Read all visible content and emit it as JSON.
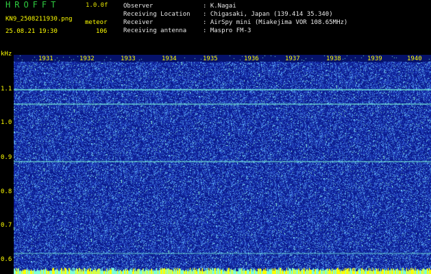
{
  "header": {
    "brand": "HROFFT",
    "version": "1.0.0f",
    "filename": "KN9_2508211930.png",
    "mode": "meteor",
    "datetime": "25.08.21 19:30",
    "count": "106"
  },
  "info": [
    {
      "label": "Observer",
      "value": ": K.Nagai"
    },
    {
      "label": "Receiving Location",
      "value": ": Chigasaki, Japan (139.414 35.340)"
    },
    {
      "label": "Receiver",
      "value": ": AirSpy mini (Miakejima VOR 108.65MHz)"
    },
    {
      "label": "Receiving antenna",
      "value": ": Maspro FM-3"
    }
  ],
  "axes": {
    "y_unit": "kHz",
    "y_ticks": [
      "1.1",
      "1.0",
      "0.9",
      "0.8",
      "0.7",
      "0.6"
    ],
    "x_ticks": [
      "1931",
      "1932",
      "1933",
      "1934",
      "1935",
      "1936",
      "1937",
      "1938",
      "1939",
      "1940"
    ]
  },
  "colors": {
    "background": "#0a1a8c",
    "noise": "#6aa8ff",
    "signal": "#7dffd8",
    "header_green": "#2ecc40",
    "header_yellow": "#ffff00"
  }
}
